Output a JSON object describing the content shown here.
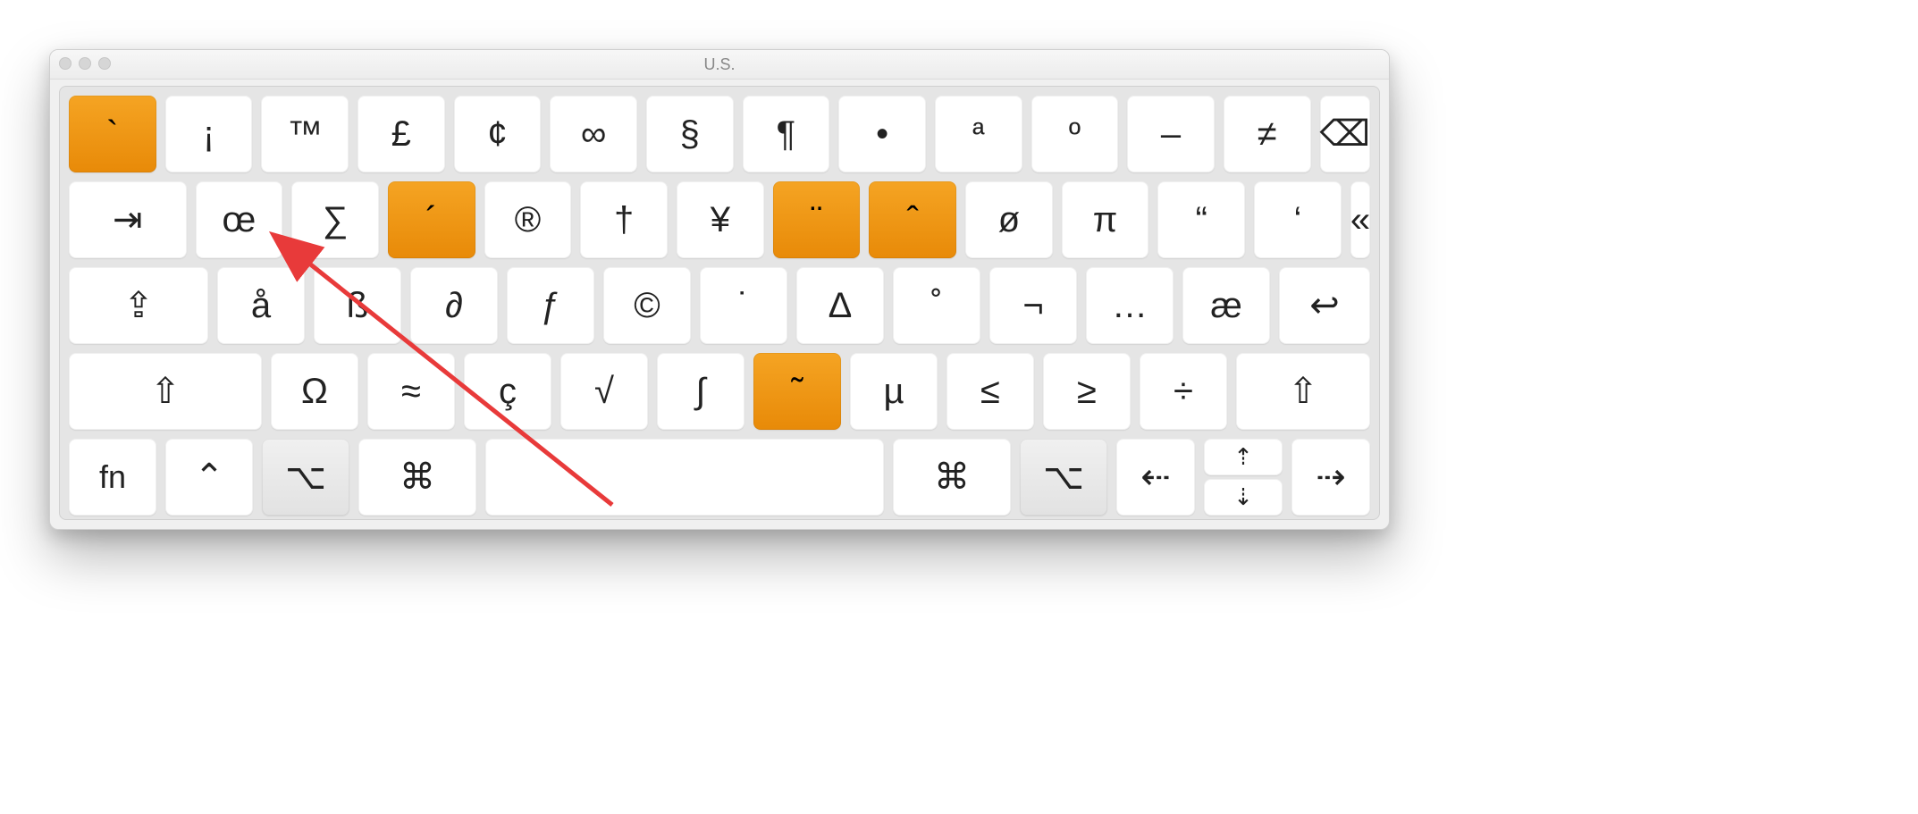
{
  "window": {
    "title": "U.S."
  },
  "row0": {
    "k0": "`",
    "k1": "¡",
    "k2": "™",
    "k3": "£",
    "k4": "¢",
    "k5": "∞",
    "k6": "§",
    "k7": "¶",
    "k8": "•",
    "k9": "ª",
    "k10": "º",
    "k11": "–",
    "k12": "≠",
    "k13": "⌫"
  },
  "row1": {
    "tab": "⇥",
    "k0": "œ",
    "k1": "∑",
    "k2": "´",
    "k3": "®",
    "k4": "†",
    "k5": "¥",
    "k6": "¨",
    "k7": "ˆ",
    "k8": "ø",
    "k9": "π",
    "k10": "“",
    "k11": "‘",
    "k12": "«"
  },
  "row2": {
    "caps": "⇪",
    "k0": "å",
    "k1": "ß",
    "k2": "∂",
    "k3": "ƒ",
    "k4": "©",
    "k5": "˙",
    "k6": "∆",
    "k7": "˚",
    "k8": "¬",
    "k9": "…",
    "k10": "æ",
    "ret": "↩"
  },
  "row3": {
    "shiftL": "⇧",
    "k0": "Ω",
    "k1": "≈",
    "k2": "ç",
    "k3": "√",
    "k4": "∫",
    "k5": "˜",
    "k6": "µ",
    "k7": "≤",
    "k8": "≥",
    "k9": "÷",
    "shiftR": "⇧"
  },
  "row4": {
    "fn": "fn",
    "ctrl": "⌃",
    "optL": "⌥",
    "cmdL": "⌘",
    "space": "",
    "cmdR": "⌘",
    "optR": "⌥",
    "left": "⇠",
    "up": "⇡",
    "down": "⇣",
    "right": "⇢"
  }
}
